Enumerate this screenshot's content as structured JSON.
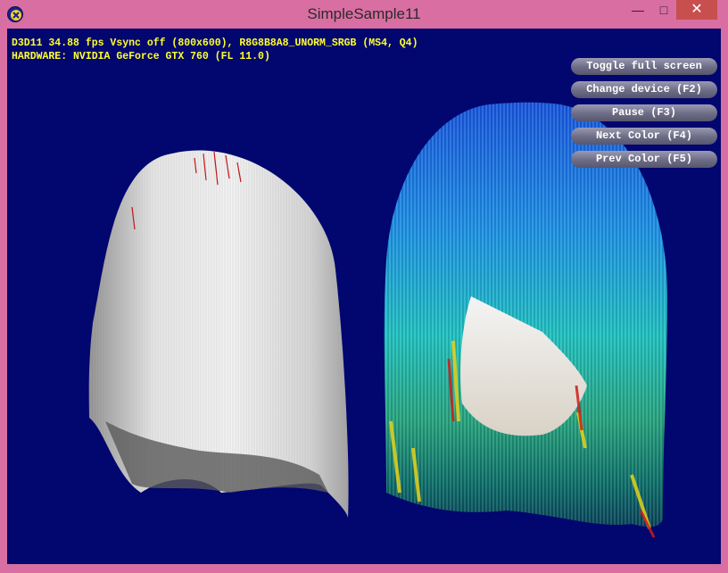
{
  "window": {
    "title": "SimpleSample11",
    "icon": "app-icon",
    "controls": {
      "minimize": "—",
      "maximize": "□",
      "close": "✕"
    }
  },
  "stats": {
    "line1": "D3D11 34.88 fps Vsync off (800x600), R8G8B8A8_UNORM_SRGB (MS4, Q4)",
    "line2": "HARDWARE: NVIDIA GeForce GTX 760 (FL 11.0)",
    "color": "#ffff2e"
  },
  "hud_buttons": [
    {
      "label": "Toggle full screen"
    },
    {
      "label": "Change device (F2)"
    },
    {
      "label": "Pause (F3)"
    },
    {
      "label": "Next Color (F4)"
    },
    {
      "label": "Prev Color (F5)"
    }
  ],
  "scene": {
    "background": "#02066f",
    "objects": [
      "white-hair-model",
      "colored-hair-model",
      "head-mesh"
    ]
  }
}
